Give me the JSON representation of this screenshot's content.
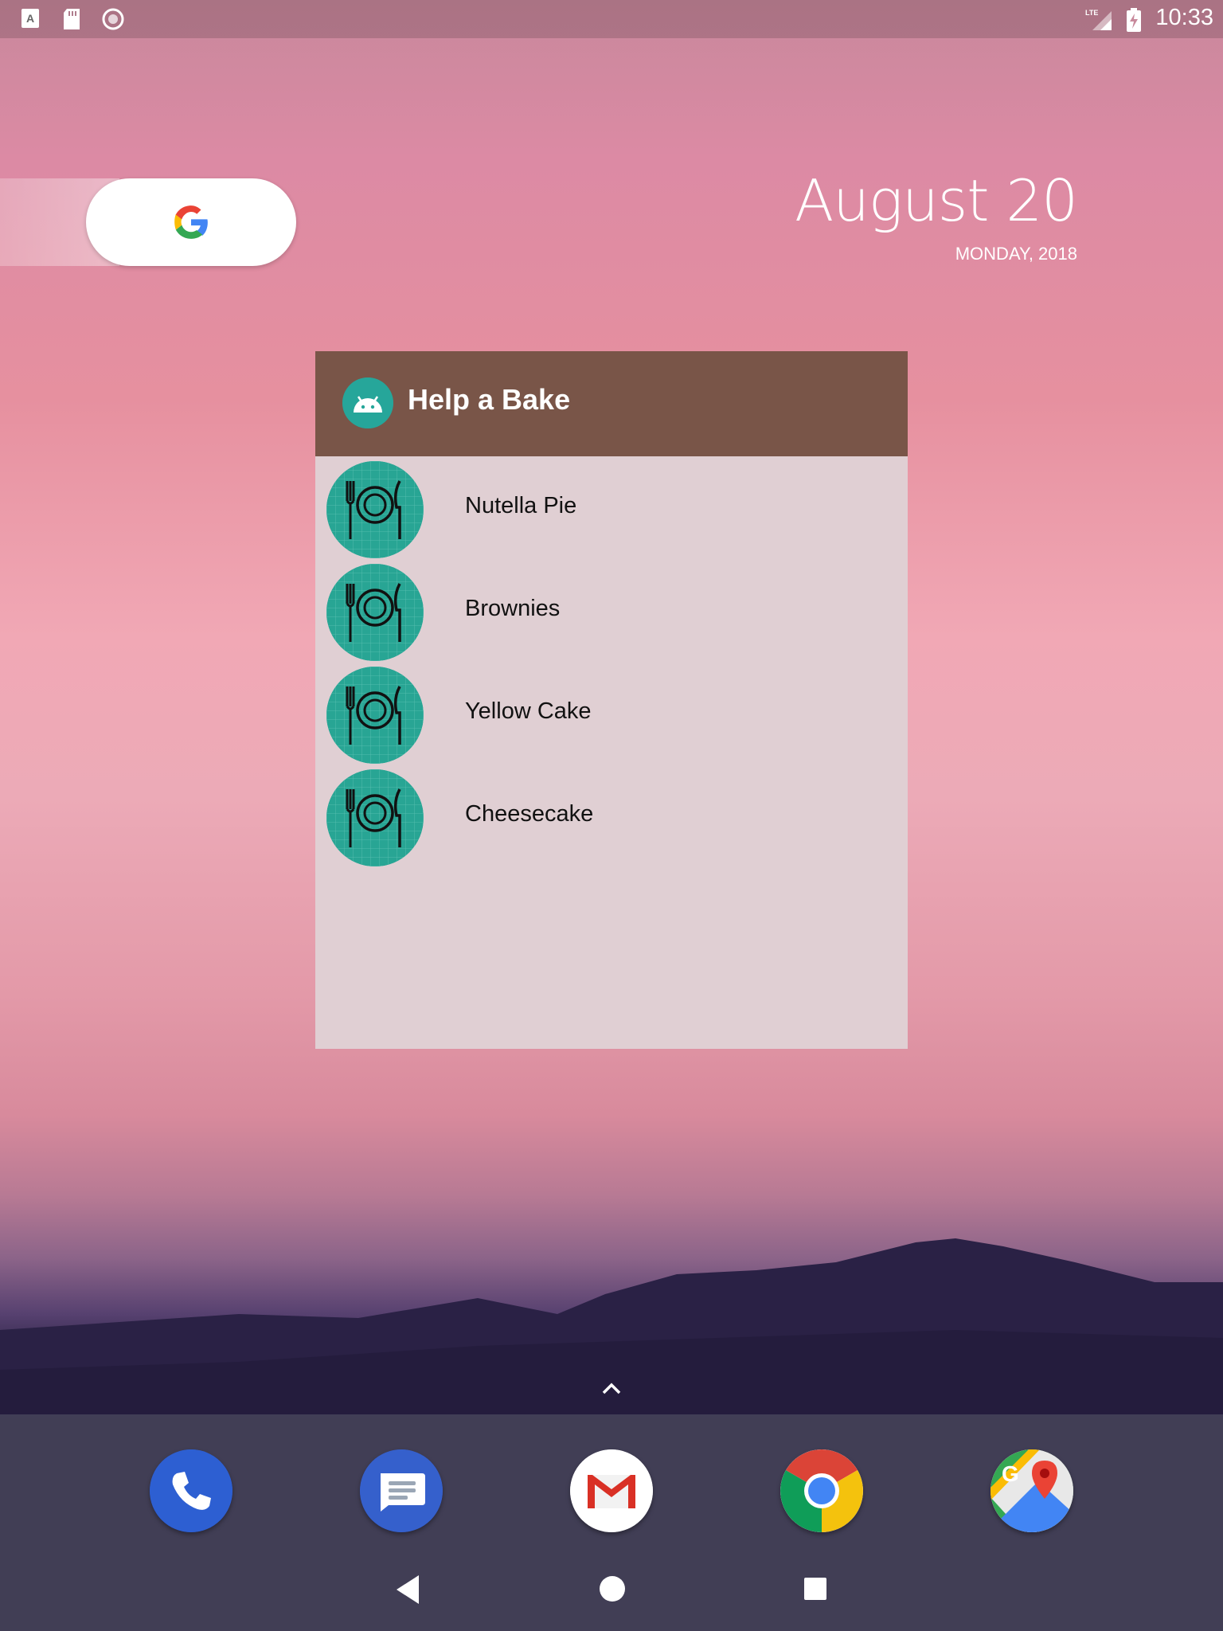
{
  "status_bar": {
    "time": "10:33",
    "network": "LTE",
    "left_icons": [
      "a-font-icon",
      "sd-card-icon",
      "record-icon"
    ],
    "right_icons": [
      "lte-signal-icon",
      "battery-charging-icon"
    ]
  },
  "search_widget": {
    "icon": "google-g-icon"
  },
  "date_widget": {
    "date": "August 20",
    "sub": "MONDAY, 2018"
  },
  "recipe_widget": {
    "title": "Help a Bake",
    "header_color": "#795548",
    "recipes": [
      {
        "name": "Nutella Pie"
      },
      {
        "name": "Brownies"
      },
      {
        "name": "Yellow Cake"
      },
      {
        "name": "Cheesecake"
      }
    ]
  },
  "dock": {
    "apps": [
      {
        "name": "Phone",
        "icon": "phone-icon"
      },
      {
        "name": "Messages",
        "icon": "messages-icon"
      },
      {
        "name": "Gmail",
        "icon": "gmail-icon"
      },
      {
        "name": "Chrome",
        "icon": "chrome-icon"
      },
      {
        "name": "Maps",
        "icon": "maps-icon"
      }
    ]
  },
  "nav_bar": {
    "buttons": [
      "back",
      "home",
      "recents"
    ]
  }
}
